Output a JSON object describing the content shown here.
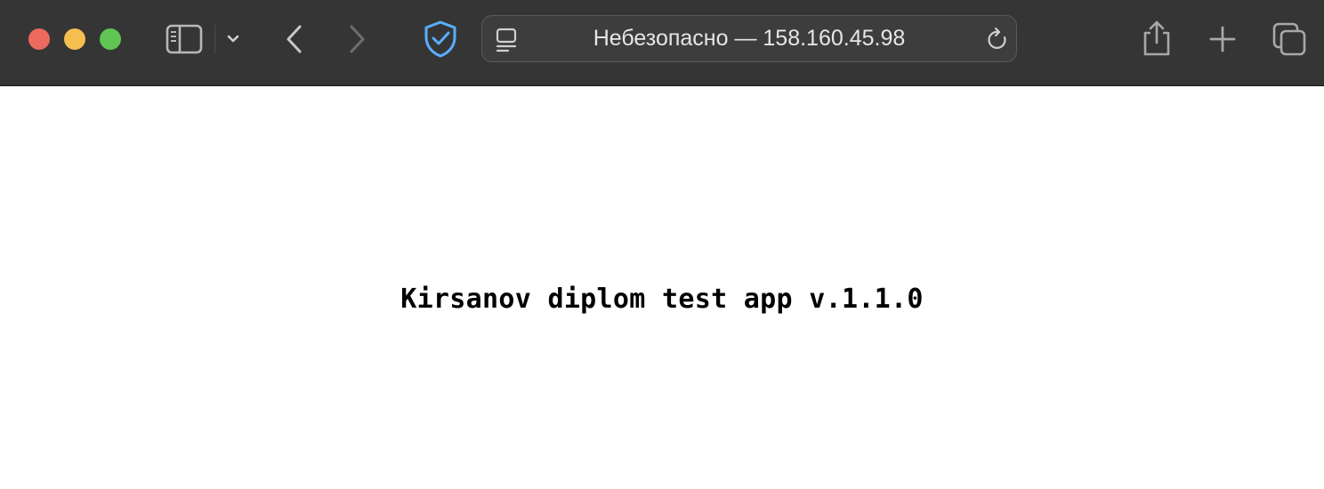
{
  "browser": {
    "address_bar": {
      "text": "Небезопасно — 158.160.45.98"
    },
    "icons": {
      "sidebar": "sidebar-icon",
      "tab_group_menu": "chevron-down-icon",
      "back": "chevron-left-icon",
      "forward": "chevron-right-icon",
      "privacy": "shield-check-icon",
      "reader": "page-reader-icon",
      "reload": "reload-icon",
      "share": "share-icon",
      "new_tab": "plus-icon",
      "tab_overview": "tabs-overview-icon"
    },
    "colors": {
      "toolbar_bg": "#353535",
      "close": "#ed6a5e",
      "minimize": "#f5bf4f",
      "maximize": "#61c554",
      "shield_accent": "#5aaeff"
    }
  },
  "page": {
    "heading": "Kirsanov diplom test app v.1.1.0"
  }
}
